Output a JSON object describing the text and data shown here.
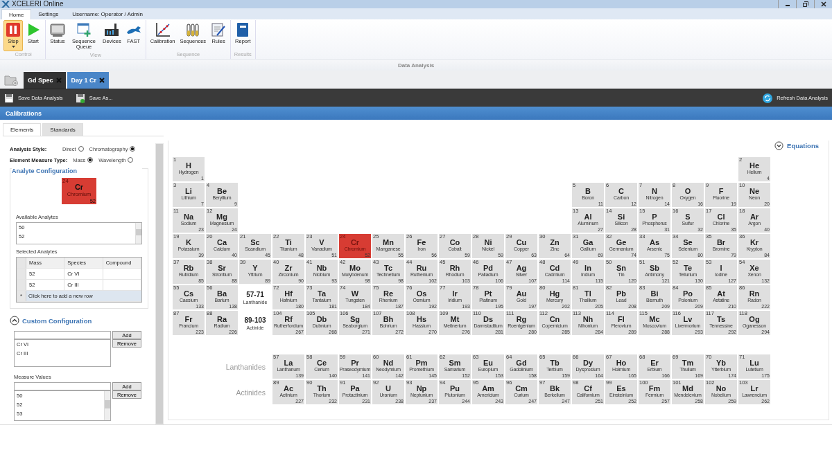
{
  "window": {
    "title": "XCELERI Online"
  },
  "menu_tabs": [
    {
      "label": "Home",
      "selected": true
    },
    {
      "label": "Settings",
      "selected": false
    },
    {
      "label": "Username: Operator / Admin",
      "selected": false
    }
  ],
  "ribbon": {
    "groups": [
      {
        "label": "Control",
        "buttons": [
          {
            "label": "Stop",
            "active": true,
            "dropdown": true
          },
          {
            "label": "Start",
            "active": false,
            "dropdown": false
          }
        ]
      },
      {
        "label": "View",
        "buttons": [
          {
            "label": "Status",
            "active": false,
            "dropdown": false
          },
          {
            "label": "Sequence Queue",
            "active": false,
            "dropdown": false
          },
          {
            "label": "Devices",
            "active": false,
            "dropdown": false
          },
          {
            "label": "FAST",
            "active": false,
            "dropdown": false
          }
        ]
      },
      {
        "label": "Sequence",
        "buttons": [
          {
            "label": "Calibration",
            "active": false,
            "dropdown": false
          },
          {
            "label": "Sequences",
            "active": false,
            "dropdown": false
          },
          {
            "label": "Rules",
            "active": false,
            "dropdown": false
          }
        ]
      },
      {
        "label": "Results",
        "buttons": [
          {
            "label": "Report",
            "active": false,
            "dropdown": false
          }
        ]
      }
    ]
  },
  "page_title": "Data Analysis",
  "documents": [
    {
      "label": "Gd Spec",
      "selected": false
    },
    {
      "label": "Day 1 Cr",
      "selected": true
    }
  ],
  "toolbar": {
    "save": "Save Data Analysis",
    "save_as": "Save As...",
    "refresh": "Refresh Data Analysis"
  },
  "section_title": "Calibrations",
  "sub_tabs": [
    {
      "label": "Elements",
      "selected": true
    },
    {
      "label": "Standards",
      "selected": false
    }
  ],
  "analysis_style": {
    "label": "Analysis Style:",
    "options": [
      {
        "label": "Direct",
        "selected": false
      },
      {
        "label": "Chromatography",
        "selected": true
      }
    ]
  },
  "measure_type": {
    "label": "Element Measure Type:",
    "options": [
      {
        "label": "Mass",
        "selected": true
      },
      {
        "label": "Wavelength",
        "selected": false
      }
    ]
  },
  "analyte_configuration": {
    "title": "Analyte Configuration",
    "element": {
      "number": "24",
      "symbol": "Cr",
      "name": "Chromium",
      "mass": "52"
    },
    "available_label": "Available Analytes",
    "available": [
      "50",
      "52"
    ],
    "selected_label": "Selected Analytes",
    "columns": [
      "Mass",
      "Species",
      "Compound"
    ],
    "rows": [
      {
        "mass": "52",
        "species": "Cr VI"
      },
      {
        "mass": "52",
        "species": "Cr III"
      }
    ],
    "new_row_marker": "*",
    "new_row": "Click here to add a new row"
  },
  "custom_configuration": {
    "title": "Custom Configuration",
    "expanded": true,
    "add": "Add",
    "remove": "Remove",
    "items": [
      "Cr VI",
      "Cr III"
    ],
    "measure_label": "Measure Values",
    "measure_add": "Add",
    "measure_remove": "Remove",
    "measure_values": [
      "50",
      "52",
      "53"
    ]
  },
  "equations": {
    "label": "Equations",
    "expanded": false
  },
  "periodic_table": {
    "periods": [
      {
        "cells": [
          {
            "kind": "element",
            "number": "1",
            "symbol": "H",
            "name": "Hydrogen",
            "mass": "1",
            "selected": false
          },
          {
            "kind": "empty"
          },
          {
            "kind": "empty"
          },
          {
            "kind": "empty"
          },
          {
            "kind": "empty"
          },
          {
            "kind": "empty"
          },
          {
            "kind": "empty"
          },
          {
            "kind": "empty"
          },
          {
            "kind": "empty"
          },
          {
            "kind": "empty"
          },
          {
            "kind": "empty"
          },
          {
            "kind": "empty"
          },
          {
            "kind": "empty"
          },
          {
            "kind": "empty"
          },
          {
            "kind": "empty"
          },
          {
            "kind": "empty"
          },
          {
            "kind": "empty"
          },
          {
            "kind": "element",
            "number": "2",
            "symbol": "He",
            "name": "Helium",
            "mass": "4",
            "selected": false
          }
        ]
      },
      {
        "cells": [
          {
            "kind": "element",
            "number": "3",
            "symbol": "Li",
            "name": "Lithium",
            "mass": "7",
            "selected": false
          },
          {
            "kind": "element",
            "number": "4",
            "symbol": "Be",
            "name": "Beryllium",
            "mass": "9",
            "selected": false
          },
          {
            "kind": "empty"
          },
          {
            "kind": "empty"
          },
          {
            "kind": "empty"
          },
          {
            "kind": "empty"
          },
          {
            "kind": "empty"
          },
          {
            "kind": "empty"
          },
          {
            "kind": "empty"
          },
          {
            "kind": "empty"
          },
          {
            "kind": "empty"
          },
          {
            "kind": "empty"
          },
          {
            "kind": "element",
            "number": "5",
            "symbol": "B",
            "name": "Boron",
            "mass": "11",
            "selected": false
          },
          {
            "kind": "element",
            "number": "6",
            "symbol": "C",
            "name": "Carbon",
            "mass": "12",
            "selected": false
          },
          {
            "kind": "element",
            "number": "7",
            "symbol": "N",
            "name": "Nitrogen",
            "mass": "14",
            "selected": false
          },
          {
            "kind": "element",
            "number": "8",
            "symbol": "O",
            "name": "Oxygen",
            "mass": "16",
            "selected": false
          },
          {
            "kind": "element",
            "number": "9",
            "symbol": "F",
            "name": "Fluorine",
            "mass": "19",
            "selected": false
          },
          {
            "kind": "element",
            "number": "10",
            "symbol": "Ne",
            "name": "Neon",
            "mass": "20",
            "selected": false
          }
        ]
      },
      {
        "cells": [
          {
            "kind": "element",
            "number": "11",
            "symbol": "Na",
            "name": "Sodium",
            "mass": "23",
            "selected": false
          },
          {
            "kind": "element",
            "number": "12",
            "symbol": "Mg",
            "name": "Magnesium",
            "mass": "24",
            "selected": false
          },
          {
            "kind": "empty"
          },
          {
            "kind": "empty"
          },
          {
            "kind": "empty"
          },
          {
            "kind": "empty"
          },
          {
            "kind": "empty"
          },
          {
            "kind": "empty"
          },
          {
            "kind": "empty"
          },
          {
            "kind": "empty"
          },
          {
            "kind": "empty"
          },
          {
            "kind": "empty"
          },
          {
            "kind": "element",
            "number": "13",
            "symbol": "Al",
            "name": "Aluminum",
            "mass": "27",
            "selected": false
          },
          {
            "kind": "element",
            "number": "14",
            "symbol": "Si",
            "name": "Silicon",
            "mass": "28",
            "selected": false
          },
          {
            "kind": "element",
            "number": "15",
            "symbol": "P",
            "name": "Phosphorus",
            "mass": "31",
            "selected": false
          },
          {
            "kind": "element",
            "number": "16",
            "symbol": "S",
            "name": "Sulfur",
            "mass": "32",
            "selected": false
          },
          {
            "kind": "element",
            "number": "17",
            "symbol": "Cl",
            "name": "Chlorine",
            "mass": "35",
            "selected": false
          },
          {
            "kind": "element",
            "number": "18",
            "symbol": "Ar",
            "name": "Argon",
            "mass": "40",
            "selected": false
          }
        ]
      },
      {
        "cells": [
          {
            "kind": "element",
            "number": "19",
            "symbol": "K",
            "name": "Potassium",
            "mass": "39",
            "selected": false
          },
          {
            "kind": "element",
            "number": "20",
            "symbol": "Ca",
            "name": "Calcium",
            "mass": "40",
            "selected": false
          },
          {
            "kind": "element",
            "number": "21",
            "symbol": "Sc",
            "name": "Scandium",
            "mass": "45",
            "selected": false
          },
          {
            "kind": "element",
            "number": "22",
            "symbol": "Ti",
            "name": "Titanium",
            "mass": "48",
            "selected": false
          },
          {
            "kind": "element",
            "number": "23",
            "symbol": "V",
            "name": "Vanadium",
            "mass": "51",
            "selected": false
          },
          {
            "kind": "element",
            "number": "24",
            "symbol": "Cr",
            "name": "Chromium",
            "mass": "52",
            "selected": true
          },
          {
            "kind": "element",
            "number": "25",
            "symbol": "Mn",
            "name": "Manganese",
            "mass": "55",
            "selected": false
          },
          {
            "kind": "element",
            "number": "26",
            "symbol": "Fe",
            "name": "Iron",
            "mass": "56",
            "selected": false
          },
          {
            "kind": "element",
            "number": "27",
            "symbol": "Co",
            "name": "Cobalt",
            "mass": "59",
            "selected": false
          },
          {
            "kind": "element",
            "number": "28",
            "symbol": "Ni",
            "name": "Nickel",
            "mass": "59",
            "selected": false
          },
          {
            "kind": "element",
            "number": "29",
            "symbol": "Cu",
            "name": "Copper",
            "mass": "63",
            "selected": false
          },
          {
            "kind": "element",
            "number": "30",
            "symbol": "Zn",
            "name": "Zinc",
            "mass": "64",
            "selected": false
          },
          {
            "kind": "element",
            "number": "31",
            "symbol": "Ga",
            "name": "Gallium",
            "mass": "69",
            "selected": false
          },
          {
            "kind": "element",
            "number": "32",
            "symbol": "Ge",
            "name": "Germanium",
            "mass": "74",
            "selected": false
          },
          {
            "kind": "element",
            "number": "33",
            "symbol": "As",
            "name": "Arsenic",
            "mass": "75",
            "selected": false
          },
          {
            "kind": "element",
            "number": "34",
            "symbol": "Se",
            "name": "Selenium",
            "mass": "80",
            "selected": false
          },
          {
            "kind": "element",
            "number": "35",
            "symbol": "Br",
            "name": "Bromine",
            "mass": "79",
            "selected": false
          },
          {
            "kind": "element",
            "number": "36",
            "symbol": "Kr",
            "name": "Krypton",
            "mass": "84",
            "selected": false
          }
        ]
      },
      {
        "cells": [
          {
            "kind": "element",
            "number": "37",
            "symbol": "Rb",
            "name": "Rubidium",
            "mass": "85",
            "selected": false
          },
          {
            "kind": "element",
            "number": "38",
            "symbol": "Sr",
            "name": "Strontium",
            "mass": "88",
            "selected": false
          },
          {
            "kind": "element",
            "number": "39",
            "symbol": "Y",
            "name": "Yttrium",
            "mass": "89",
            "selected": false
          },
          {
            "kind": "element",
            "number": "40",
            "symbol": "Zr",
            "name": "Zirconium",
            "mass": "90",
            "selected": false
          },
          {
            "kind": "element",
            "number": "41",
            "symbol": "Nb",
            "name": "Niobium",
            "mass": "93",
            "selected": false
          },
          {
            "kind": "element",
            "number": "42",
            "symbol": "Mo",
            "name": "Molybdenum",
            "mass": "98",
            "selected": false
          },
          {
            "kind": "element",
            "number": "43",
            "symbol": "Tc",
            "name": "Technetium",
            "mass": "98",
            "selected": false
          },
          {
            "kind": "element",
            "number": "44",
            "symbol": "Ru",
            "name": "Ruthenium",
            "mass": "102",
            "selected": false
          },
          {
            "kind": "element",
            "number": "45",
            "symbol": "Rh",
            "name": "Rhodium",
            "mass": "103",
            "selected": false
          },
          {
            "kind": "element",
            "number": "46",
            "symbol": "Pd",
            "name": "Palladium",
            "mass": "106",
            "selected": false
          },
          {
            "kind": "element",
            "number": "47",
            "symbol": "Ag",
            "name": "Silver",
            "mass": "107",
            "selected": false
          },
          {
            "kind": "element",
            "number": "48",
            "symbol": "Cd",
            "name": "Cadmium",
            "mass": "114",
            "selected": false
          },
          {
            "kind": "element",
            "number": "49",
            "symbol": "In",
            "name": "Indium",
            "mass": "115",
            "selected": false
          },
          {
            "kind": "element",
            "number": "50",
            "symbol": "Sn",
            "name": "Tin",
            "mass": "120",
            "selected": false
          },
          {
            "kind": "element",
            "number": "51",
            "symbol": "Sb",
            "name": "Antimony",
            "mass": "121",
            "selected": false
          },
          {
            "kind": "element",
            "number": "52",
            "symbol": "Te",
            "name": "Tellurium",
            "mass": "130",
            "selected": false
          },
          {
            "kind": "element",
            "number": "53",
            "symbol": "I",
            "name": "Iodine",
            "mass": "127",
            "selected": false
          },
          {
            "kind": "element",
            "number": "54",
            "symbol": "Xe",
            "name": "Xenon",
            "mass": "132",
            "selected": false
          }
        ]
      },
      {
        "cells": [
          {
            "kind": "element",
            "number": "55",
            "symbol": "Cs",
            "name": "Caesium",
            "mass": "133",
            "selected": false
          },
          {
            "kind": "element",
            "number": "56",
            "symbol": "Ba",
            "name": "Barium",
            "mass": "138",
            "selected": false
          },
          {
            "kind": "range",
            "range": "57-71",
            "name": "Lanthanide"
          },
          {
            "kind": "element",
            "number": "72",
            "symbol": "Hf",
            "name": "Hafnium",
            "mass": "180",
            "selected": false
          },
          {
            "kind": "element",
            "number": "73",
            "symbol": "Ta",
            "name": "Tantalum",
            "mass": "181",
            "selected": false
          },
          {
            "kind": "element",
            "number": "74",
            "symbol": "W",
            "name": "Tungsten",
            "mass": "184",
            "selected": false
          },
          {
            "kind": "element",
            "number": "75",
            "symbol": "Re",
            "name": "Rhenium",
            "mass": "187",
            "selected": false
          },
          {
            "kind": "element",
            "number": "76",
            "symbol": "Os",
            "name": "Osmium",
            "mass": "192",
            "selected": false
          },
          {
            "kind": "element",
            "number": "77",
            "symbol": "Ir",
            "name": "Iridium",
            "mass": "193",
            "selected": false
          },
          {
            "kind": "element",
            "number": "78",
            "symbol": "Pt",
            "name": "Platinum",
            "mass": "195",
            "selected": false
          },
          {
            "kind": "element",
            "number": "79",
            "symbol": "Au",
            "name": "Gold",
            "mass": "197",
            "selected": false
          },
          {
            "kind": "element",
            "number": "80",
            "symbol": "Hg",
            "name": "Mercury",
            "mass": "202",
            "selected": false
          },
          {
            "kind": "element",
            "number": "81",
            "symbol": "Tl",
            "name": "Thallium",
            "mass": "205",
            "selected": false
          },
          {
            "kind": "element",
            "number": "82",
            "symbol": "Pb",
            "name": "Lead",
            "mass": "208",
            "selected": false
          },
          {
            "kind": "element",
            "number": "83",
            "symbol": "Bi",
            "name": "Bismuth",
            "mass": "209",
            "selected": false
          },
          {
            "kind": "element",
            "number": "84",
            "symbol": "Po",
            "name": "Polonium",
            "mass": "209",
            "selected": false
          },
          {
            "kind": "element",
            "number": "85",
            "symbol": "At",
            "name": "Astatine",
            "mass": "210",
            "selected": false
          },
          {
            "kind": "element",
            "number": "86",
            "symbol": "Rn",
            "name": "Radon",
            "mass": "222",
            "selected": false
          }
        ]
      },
      {
        "cells": [
          {
            "kind": "element",
            "number": "87",
            "symbol": "Fr",
            "name": "Francium",
            "mass": "223",
            "selected": false
          },
          {
            "kind": "element",
            "number": "88",
            "symbol": "Ra",
            "name": "Radium",
            "mass": "226",
            "selected": false
          },
          {
            "kind": "range",
            "range": "89-103",
            "name": "Actinide"
          },
          {
            "kind": "element",
            "number": "104",
            "symbol": "Rf",
            "name": "Rutherfordium",
            "mass": "267",
            "selected": false
          },
          {
            "kind": "element",
            "number": "105",
            "symbol": "Db",
            "name": "Dubnium",
            "mass": "268",
            "selected": false
          },
          {
            "kind": "element",
            "number": "106",
            "symbol": "Sg",
            "name": "Seaborgium",
            "mass": "271",
            "selected": false
          },
          {
            "kind": "element",
            "number": "107",
            "symbol": "Bh",
            "name": "Bohrium",
            "mass": "272",
            "selected": false
          },
          {
            "kind": "element",
            "number": "108",
            "symbol": "Hs",
            "name": "Hassium",
            "mass": "270",
            "selected": false
          },
          {
            "kind": "element",
            "number": "109",
            "symbol": "Mt",
            "name": "Meitnerium",
            "mass": "276",
            "selected": false
          },
          {
            "kind": "element",
            "number": "110",
            "symbol": "Ds",
            "name": "Darmstadtium",
            "mass": "281",
            "selected": false
          },
          {
            "kind": "element",
            "number": "111",
            "symbol": "Rg",
            "name": "Roentgenium",
            "mass": "280",
            "selected": false
          },
          {
            "kind": "element",
            "number": "112",
            "symbol": "Cn",
            "name": "Copernicium",
            "mass": "285",
            "selected": false
          },
          {
            "kind": "element",
            "number": "113",
            "symbol": "Nh",
            "name": "Nihonium",
            "mass": "284",
            "selected": false
          },
          {
            "kind": "element",
            "number": "114",
            "symbol": "Fl",
            "name": "Flerovium",
            "mass": "289",
            "selected": false
          },
          {
            "kind": "element",
            "number": "115",
            "symbol": "Mc",
            "name": "Moscovium",
            "mass": "288",
            "selected": false
          },
          {
            "kind": "element",
            "number": "116",
            "symbol": "Lv",
            "name": "Livermorium",
            "mass": "293",
            "selected": false
          },
          {
            "kind": "element",
            "number": "117",
            "symbol": "Ts",
            "name": "Tennessine",
            "mass": "292",
            "selected": false
          },
          {
            "kind": "element",
            "number": "118",
            "symbol": "Og",
            "name": "Oganesson",
            "mass": "294",
            "selected": false
          }
        ]
      }
    ],
    "series": [
      {
        "label": "Lanthanides",
        "cells": [
          {
            "kind": "element",
            "number": "57",
            "symbol": "La",
            "name": "Lanthanum",
            "mass": "139",
            "selected": false
          },
          {
            "kind": "element",
            "number": "58",
            "symbol": "Ce",
            "name": "Cerium",
            "mass": "140",
            "selected": false
          },
          {
            "kind": "element",
            "number": "59",
            "symbol": "Pr",
            "name": "Praseodymium",
            "mass": "141",
            "selected": false
          },
          {
            "kind": "element",
            "number": "60",
            "symbol": "Nd",
            "name": "Neodymium",
            "mass": "142",
            "selected": false
          },
          {
            "kind": "element",
            "number": "61",
            "symbol": "Pm",
            "name": "Promethium",
            "mass": "145",
            "selected": false
          },
          {
            "kind": "element",
            "number": "62",
            "symbol": "Sm",
            "name": "Samarium",
            "mass": "152",
            "selected": false
          },
          {
            "kind": "element",
            "number": "63",
            "symbol": "Eu",
            "name": "Europium",
            "mass": "153",
            "selected": false
          },
          {
            "kind": "element",
            "number": "64",
            "symbol": "Gd",
            "name": "Gadolinium",
            "mass": "158",
            "selected": false
          },
          {
            "kind": "element",
            "number": "65",
            "symbol": "Tb",
            "name": "Terbium",
            "mass": "159",
            "selected": false
          },
          {
            "kind": "element",
            "number": "66",
            "symbol": "Dy",
            "name": "Dysprosium",
            "mass": "164",
            "selected": false
          },
          {
            "kind": "element",
            "number": "67",
            "symbol": "Ho",
            "name": "Holmium",
            "mass": "165",
            "selected": false
          },
          {
            "kind": "element",
            "number": "68",
            "symbol": "Er",
            "name": "Erbium",
            "mass": "166",
            "selected": false
          },
          {
            "kind": "element",
            "number": "69",
            "symbol": "Tm",
            "name": "Thulium",
            "mass": "169",
            "selected": false
          },
          {
            "kind": "element",
            "number": "70",
            "symbol": "Yb",
            "name": "Ytterbium",
            "mass": "174",
            "selected": false
          },
          {
            "kind": "element",
            "number": "71",
            "symbol": "Lu",
            "name": "Lutetium",
            "mass": "175",
            "selected": false
          }
        ]
      },
      {
        "label": "Actinides",
        "cells": [
          {
            "kind": "element",
            "number": "89",
            "symbol": "Ac",
            "name": "Actinium",
            "mass": "227",
            "selected": false
          },
          {
            "kind": "element",
            "number": "90",
            "symbol": "Th",
            "name": "Thorium",
            "mass": "232",
            "selected": false
          },
          {
            "kind": "element",
            "number": "91",
            "symbol": "Pa",
            "name": "Protactinium",
            "mass": "231",
            "selected": false
          },
          {
            "kind": "element",
            "number": "92",
            "symbol": "U",
            "name": "Uranium",
            "mass": "238",
            "selected": false
          },
          {
            "kind": "element",
            "number": "93",
            "symbol": "Np",
            "name": "Neptunium",
            "mass": "237",
            "selected": false
          },
          {
            "kind": "element",
            "number": "94",
            "symbol": "Pu",
            "name": "Plutonium",
            "mass": "244",
            "selected": false
          },
          {
            "kind": "element",
            "number": "95",
            "symbol": "Am",
            "name": "Americium",
            "mass": "243",
            "selected": false
          },
          {
            "kind": "element",
            "number": "96",
            "symbol": "Cm",
            "name": "Curium",
            "mass": "247",
            "selected": false
          },
          {
            "kind": "element",
            "number": "97",
            "symbol": "Bk",
            "name": "Berkelium",
            "mass": "247",
            "selected": false
          },
          {
            "kind": "element",
            "number": "98",
            "symbol": "Cf",
            "name": "Californium",
            "mass": "251",
            "selected": false
          },
          {
            "kind": "element",
            "number": "99",
            "symbol": "Es",
            "name": "Einsteinium",
            "mass": "252",
            "selected": false
          },
          {
            "kind": "element",
            "number": "100",
            "symbol": "Fm",
            "name": "Fermium",
            "mass": "257",
            "selected": false
          },
          {
            "kind": "element",
            "number": "101",
            "symbol": "Md",
            "name": "Mendelevium",
            "mass": "258",
            "selected": false
          },
          {
            "kind": "element",
            "number": "102",
            "symbol": "No",
            "name": "Nobelium",
            "mass": "259",
            "selected": false
          },
          {
            "kind": "element",
            "number": "103",
            "symbol": "Lr",
            "name": "Lawrencium",
            "mass": "262",
            "selected": false
          }
        ]
      }
    ]
  }
}
